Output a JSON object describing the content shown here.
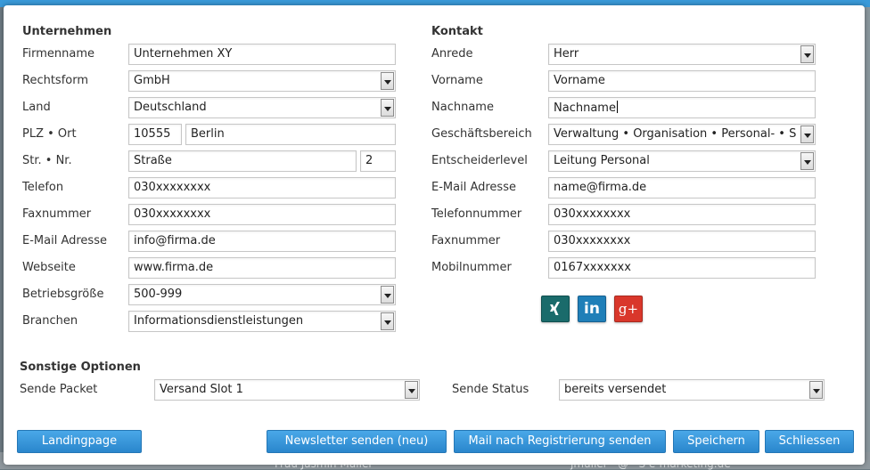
{
  "background": {
    "row_text": "Frau Jasmin Müller",
    "row_text2": "jmuller · @ · S e-marketing.de"
  },
  "company": {
    "title": "Unternehmen",
    "firmenname": {
      "label": "Firmenname",
      "value": "Unternehmen XY"
    },
    "rechtsform": {
      "label": "Rechtsform",
      "value": "GmbH"
    },
    "land": {
      "label": "Land",
      "value": "Deutschland"
    },
    "plz_ort": {
      "label": "PLZ • Ort",
      "plz": "10555",
      "ort": "Berlin"
    },
    "str_nr": {
      "label": "Str. • Nr.",
      "strasse": "Straße",
      "nr": "2"
    },
    "telefon": {
      "label": "Telefon",
      "value": "030xxxxxxxx"
    },
    "fax": {
      "label": "Faxnummer",
      "value": "030xxxxxxxx"
    },
    "email": {
      "label": "E-Mail Adresse",
      "value": "info@firma.de"
    },
    "webseite": {
      "label": "Webseite",
      "value": "www.firma.de"
    },
    "groesse": {
      "label": "Betriebsgröße",
      "value": "500-999"
    },
    "branchen": {
      "label": "Branchen",
      "value": "Informationsdienstleistungen"
    }
  },
  "contact": {
    "title": "Kontakt",
    "anrede": {
      "label": "Anrede",
      "value": "Herr"
    },
    "vorname": {
      "label": "Vorname",
      "value": "Vorname"
    },
    "nachname": {
      "label": "Nachname",
      "value": "Nachname"
    },
    "bereich": {
      "label": "Geschäftsbereich",
      "value": "Verwaltung • Organisation • Personal- • S"
    },
    "level": {
      "label": "Entscheiderlevel",
      "value": "Leitung Personal"
    },
    "email": {
      "label": "E-Mail Adresse",
      "value": "name@firma.de"
    },
    "telefon": {
      "label": "Telefonnummer",
      "value": "030xxxxxxxx"
    },
    "fax": {
      "label": "Faxnummer",
      "value": "030xxxxxxxx"
    },
    "mobil": {
      "label": "Mobilnummer",
      "value": "0167xxxxxxx"
    }
  },
  "social": {
    "xing": {
      "icon": "xing-icon",
      "color": "#1a6b6b"
    },
    "linkedin": {
      "icon": "linkedin-icon",
      "color": "#1f7fb8",
      "text": "in"
    },
    "googleplus": {
      "icon": "google-plus-icon",
      "color": "#d9372b",
      "text": "g+"
    }
  },
  "options": {
    "title": "Sonstige Optionen",
    "packet": {
      "label": "Sende Packet",
      "value": "Versand Slot 1"
    },
    "status": {
      "label": "Sende Status",
      "value": "bereits versendet"
    }
  },
  "buttons": {
    "landingpage": "Landingpage",
    "newsletter": "Newsletter senden (neu)",
    "mail_registrierung": "Mail nach Registrierung senden",
    "speichern": "Speichern",
    "schliessen": "Schliessen"
  }
}
